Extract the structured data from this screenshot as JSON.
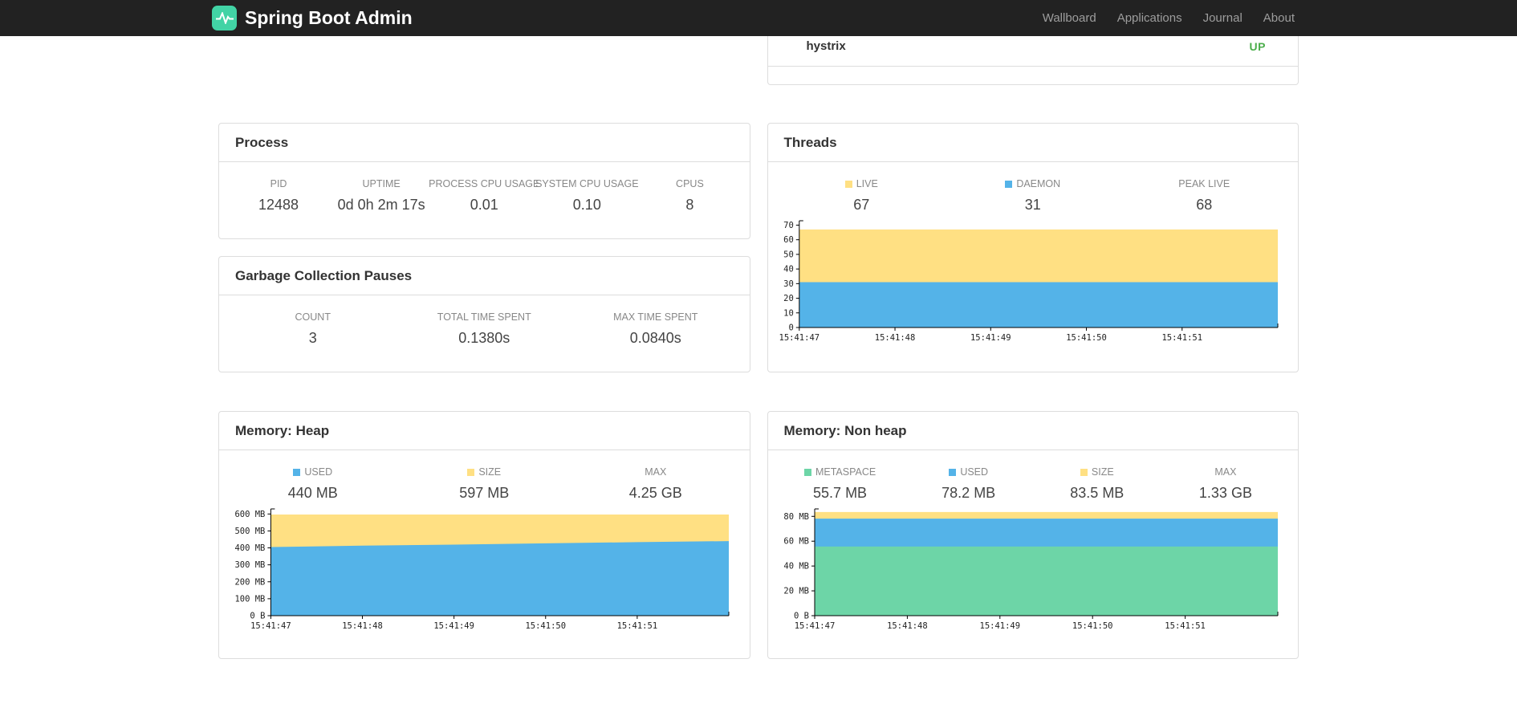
{
  "navbar": {
    "brand": "Spring Boot Admin",
    "items": [
      {
        "label": "Wallboard"
      },
      {
        "label": "Applications"
      },
      {
        "label": "Journal"
      },
      {
        "label": "About"
      }
    ]
  },
  "service_panel": {
    "rows": [
      {
        "name": "hystrix",
        "status": "UP"
      }
    ],
    "status_color": "#4cae4c"
  },
  "panels": {
    "process": {
      "title": "Process",
      "stats": [
        {
          "label": "PID",
          "value": "12488"
        },
        {
          "label": "UPTIME",
          "value": "0d 0h 2m 17s"
        },
        {
          "label": "PROCESS CPU USAGE",
          "value": "0.01"
        },
        {
          "label": "SYSTEM CPU USAGE",
          "value": "0.10"
        },
        {
          "label": "CPUS",
          "value": "8"
        }
      ]
    },
    "gc": {
      "title": "Garbage Collection Pauses",
      "stats": [
        {
          "label": "COUNT",
          "value": "3"
        },
        {
          "label": "TOTAL TIME SPENT",
          "value": "0.1380s"
        },
        {
          "label": "MAX TIME SPENT",
          "value": "0.0840s"
        }
      ]
    },
    "threads": {
      "title": "Threads",
      "stats": [
        {
          "label": "LIVE",
          "value": "67",
          "swatch": "#ffe083"
        },
        {
          "label": "DAEMON",
          "value": "31",
          "swatch": "#54b3e8"
        },
        {
          "label": "PEAK LIVE",
          "value": "68"
        }
      ]
    },
    "heap": {
      "title": "Memory: Heap",
      "stats": [
        {
          "label": "USED",
          "value": "440 MB",
          "swatch": "#54b3e8"
        },
        {
          "label": "SIZE",
          "value": "597 MB",
          "swatch": "#ffe083"
        },
        {
          "label": "MAX",
          "value": "4.25 GB"
        }
      ]
    },
    "nonheap": {
      "title": "Memory: Non heap",
      "stats": [
        {
          "label": "METASPACE",
          "value": "55.7 MB",
          "swatch": "#6dd5a7"
        },
        {
          "label": "USED",
          "value": "78.2 MB",
          "swatch": "#54b3e8"
        },
        {
          "label": "SIZE",
          "value": "83.5 MB",
          "swatch": "#ffe083"
        },
        {
          "label": "MAX",
          "value": "1.33 GB"
        }
      ]
    }
  },
  "chart_data": [
    {
      "id": "threads",
      "type": "area",
      "title": "Threads",
      "legend_position": "top",
      "grid": false,
      "x_tick_labels": [
        "15:41:47",
        "15:41:48",
        "15:41:49",
        "15:41:50",
        "15:41:51"
      ],
      "ylim": [
        0,
        73
      ],
      "yticks": [
        {
          "v": 0,
          "label": "0"
        },
        {
          "v": 10,
          "label": "10"
        },
        {
          "v": 20,
          "label": "20"
        },
        {
          "v": 30,
          "label": "30"
        },
        {
          "v": 40,
          "label": "40"
        },
        {
          "v": 50,
          "label": "50"
        },
        {
          "v": 60,
          "label": "60"
        },
        {
          "v": 70,
          "label": "70"
        }
      ],
      "series": [
        {
          "name": "LIVE",
          "color": "#ffe083",
          "values": [
            67,
            67,
            67,
            67,
            67,
            67
          ]
        },
        {
          "name": "DAEMON",
          "color": "#54b3e8",
          "values": [
            31,
            31,
            31,
            31,
            31,
            31
          ]
        }
      ]
    },
    {
      "id": "memory-heap",
      "type": "area",
      "title": "Memory: Heap",
      "legend_position": "top",
      "grid": false,
      "x_tick_labels": [
        "15:41:47",
        "15:41:48",
        "15:41:49",
        "15:41:50",
        "15:41:51"
      ],
      "ylim": [
        0,
        630
      ],
      "yticks": [
        {
          "v": 0,
          "label": "0 B"
        },
        {
          "v": 100,
          "label": "100 MB"
        },
        {
          "v": 200,
          "label": "200 MB"
        },
        {
          "v": 300,
          "label": "300 MB"
        },
        {
          "v": 400,
          "label": "400 MB"
        },
        {
          "v": 500,
          "label": "500 MB"
        },
        {
          "v": 600,
          "label": "600 MB"
        }
      ],
      "series": [
        {
          "name": "SIZE",
          "color": "#ffe083",
          "values": [
            597,
            597,
            597,
            597,
            597,
            597
          ]
        },
        {
          "name": "USED",
          "color": "#54b3e8",
          "values": [
            405,
            413,
            419,
            427,
            434,
            440
          ]
        }
      ]
    },
    {
      "id": "memory-non-heap",
      "type": "area",
      "title": "Memory: Non heap",
      "legend_position": "top",
      "grid": false,
      "x_tick_labels": [
        "15:41:47",
        "15:41:48",
        "15:41:49",
        "15:41:50",
        "15:41:51"
      ],
      "ylim": [
        0,
        86
      ],
      "yticks": [
        {
          "v": 0,
          "label": "0 B"
        },
        {
          "v": 20,
          "label": "20 MB"
        },
        {
          "v": 40,
          "label": "40 MB"
        },
        {
          "v": 60,
          "label": "60 MB"
        },
        {
          "v": 80,
          "label": "80 MB"
        }
      ],
      "series": [
        {
          "name": "SIZE",
          "color": "#ffe083",
          "values": [
            83.5,
            83.5,
            83.5,
            83.5,
            83.5,
            83.5
          ]
        },
        {
          "name": "USED",
          "color": "#54b3e8",
          "values": [
            78.2,
            78.2,
            78.2,
            78.2,
            78.2,
            78.2
          ]
        },
        {
          "name": "METASPACE",
          "color": "#6dd5a7",
          "values": [
            55.7,
            55.7,
            55.7,
            55.7,
            55.7,
            55.7
          ]
        }
      ]
    }
  ]
}
